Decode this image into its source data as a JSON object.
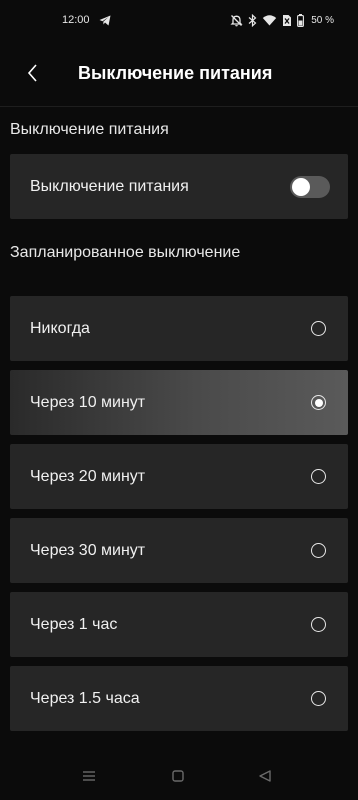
{
  "status_bar": {
    "time": "12:00",
    "battery": "50 %",
    "icons": [
      "telegram-icon",
      "mute-icon",
      "bluetooth-icon",
      "wifi-icon",
      "no-sim-icon",
      "battery-icon"
    ]
  },
  "header": {
    "back_icon": "chevron-left-icon",
    "title": "Выключение питания"
  },
  "power_section": {
    "header": "Выключение питания",
    "toggle_label": "Выключение питания",
    "toggle_on": false
  },
  "schedule_section": {
    "header": "Запланированное выключение",
    "selected_index": 1,
    "options": [
      {
        "label": "Никогда"
      },
      {
        "label": "Через 10 минут"
      },
      {
        "label": "Через 20 минут"
      },
      {
        "label": "Через 30 минут"
      },
      {
        "label": "Через 1 час"
      },
      {
        "label": "Через 1.5 часа"
      }
    ]
  },
  "nav_bar": {
    "icons": [
      "menu-icon",
      "home-icon",
      "back-triangle-icon"
    ]
  },
  "colors": {
    "background": "#0b0b0b",
    "card": "#262626",
    "text": "#ffffff",
    "toggle_off": "#5a5a5a"
  }
}
